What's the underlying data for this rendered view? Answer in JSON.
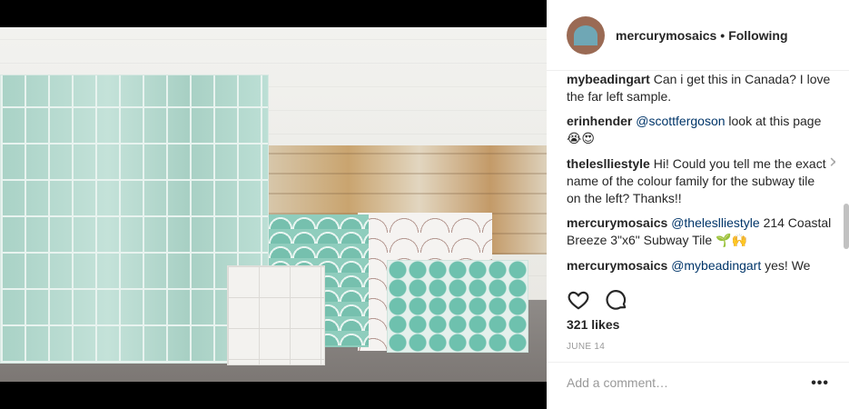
{
  "post": {
    "username": "mercurymosaics",
    "separator": "•",
    "follow_status": "Following"
  },
  "comments": [
    {
      "user": "mybeadingart",
      "text": "Can i get this in Canada? I love the far left sample."
    },
    {
      "user": "erinhender",
      "mention": "@scottfergoson",
      "text": "look at this page",
      "emoji": "😭😍"
    },
    {
      "user": "theleslliestyle",
      "text": "Hi! Could you tell me the exact name of the colour family for the subway tile on the left? Thanks!!",
      "close": "✕"
    },
    {
      "user": "mercurymosaics",
      "mention": "@theleslliestyle",
      "text": "214 Coastal Breeze 3\"x6\" Subway Tile",
      "emoji": "🌱🙌"
    },
    {
      "user": "mercurymosaics",
      "mention": "@mybeadingart",
      "text": "yes! We ship globally. Just inquire with: sales@mercurymosaics.com for pricing &"
    }
  ],
  "actions": {
    "like_icon": "heart-icon",
    "comment_icon": "comment-bubble-icon"
  },
  "likes": "321 likes",
  "date": "JUNE 14",
  "add_comment": {
    "placeholder": "Add a comment…",
    "more": "•••"
  },
  "colors": {
    "mention": "#003569",
    "text": "#262626",
    "muted": "#999999"
  }
}
